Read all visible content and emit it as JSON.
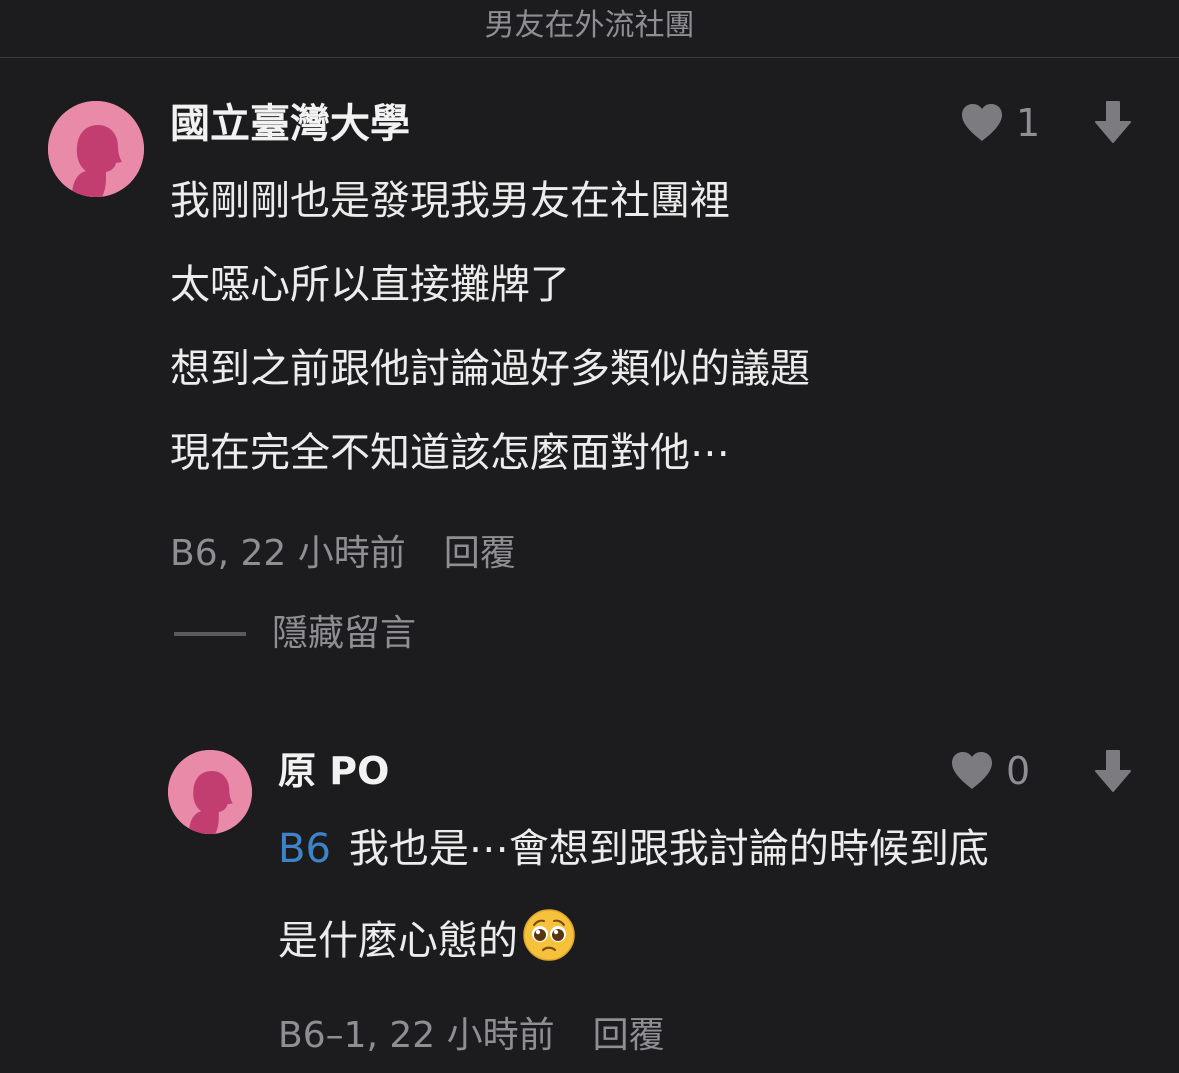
{
  "header": {
    "title": "男友在外流社團"
  },
  "comments": [
    {
      "author": "國立臺灣大學",
      "likes": "1",
      "lines": [
        "我剛剛也是發現我男友在社團裡",
        "太噁心所以直接攤牌了",
        "想到之前跟他討論過好多類似的議題",
        "現在完全不知道該怎麼面對他⋯"
      ],
      "floor_time": "B6, 22 小時前",
      "reply_label": "回覆",
      "hide_label": "隱藏留言",
      "icons": {
        "avatar": "avatar-silhouette-icon",
        "like": "heart-icon",
        "dislike": "down-arrow-icon"
      }
    }
  ],
  "replies": [
    {
      "author": "原 PO",
      "likes": "0",
      "floor_ref": "B6",
      "line1": "我也是⋯會想到跟我討論的時候到底",
      "line2": "是什麼心態的",
      "emoji": "pleading-face-emoji",
      "floor_time": "B6–1, 22 小時前",
      "reply_label": "回覆"
    }
  ],
  "colors": {
    "background": "#1c1c1e",
    "avatar": "#e98aa9",
    "silhouette": "#c23e70",
    "muted": "#8e8e93",
    "link": "#3e82c8"
  }
}
